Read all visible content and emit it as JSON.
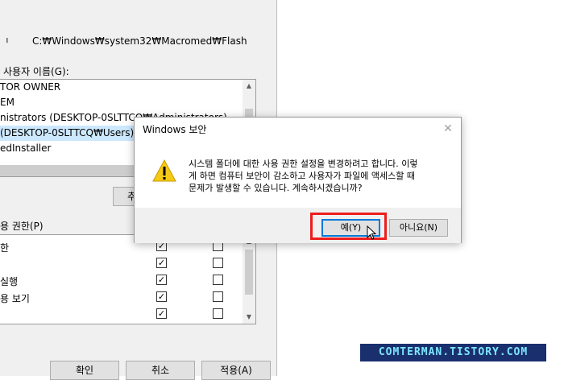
{
  "background_dialog": {
    "object_label": "ᅵ",
    "object_path": "C:₩Windows₩system32₩Macromed₩Flash",
    "groups_label": "사용자 이름(G):",
    "groups": [
      "TOR OWNER",
      "EM",
      "nistrators (DESKTOP-0SLTTCQ₩Administrators)",
      "(DESKTOP-0SLTTCQ₩Users)",
      "edInstaller"
    ],
    "add_button_label": "추가",
    "permissions_label": "용 권한(P)",
    "permissions": [
      {
        "name": "한",
        "allow": true,
        "deny": false
      },
      {
        "name": "",
        "allow": true,
        "deny": false
      },
      {
        "name": "실행",
        "allow": true,
        "deny": false
      },
      {
        "name": "용 보기",
        "allow": true,
        "deny": false
      },
      {
        "name": "",
        "allow": true,
        "deny": false
      }
    ],
    "ok_label": "확인",
    "cancel_label": "취소",
    "apply_label": "적용(A)"
  },
  "security_dialog": {
    "title": "Windows 보안",
    "close_icon": "close-icon",
    "warning_icon": "warning-icon",
    "message_line1": "시스템 폴더에 대한 사용 권한 설정을 변경하려고 합니다. 이렇",
    "message_line2": "게 하면 컴퓨터 보안이 감소하고 사용자가 파일에 액세스할 때",
    "message_line3": "문제가 발생할 수 있습니다. 계속하시겠습니까?",
    "yes_label": "예(Y)",
    "no_label": "아니요(N)"
  },
  "watermark": "COMTERMAN.TISTORY.COM",
  "colors": {
    "highlight": "#ee1c1c",
    "selection": "#cce8ff",
    "watermark_bg": "#1a2f6e",
    "watermark_fg": "#7ce6ff"
  }
}
